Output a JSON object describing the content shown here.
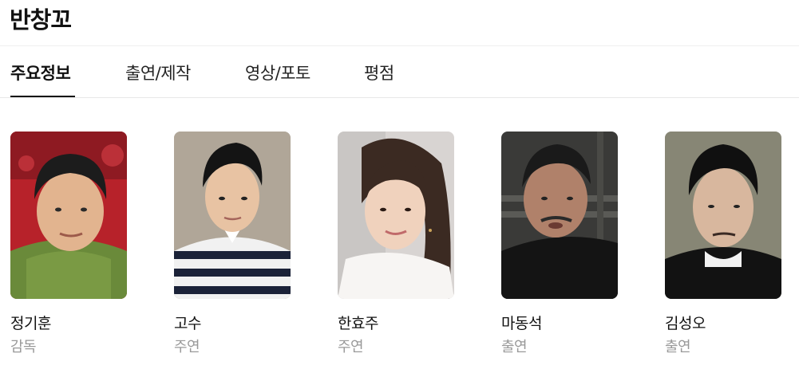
{
  "page": {
    "title": "반창꼬"
  },
  "tabs": [
    {
      "label": "주요정보",
      "active": true
    },
    {
      "label": "출연/제작",
      "active": false
    },
    {
      "label": "영상/포토",
      "active": false
    },
    {
      "label": "평점",
      "active": false
    }
  ],
  "cast": [
    {
      "name": "정기훈",
      "role": "감독",
      "photo_icon": "person-photo-director"
    },
    {
      "name": "고수",
      "role": "주연",
      "photo_icon": "person-photo-lead"
    },
    {
      "name": "한효주",
      "role": "주연",
      "photo_icon": "person-photo-lead"
    },
    {
      "name": "마동석",
      "role": "출연",
      "photo_icon": "person-photo-supporting"
    },
    {
      "name": "김성오",
      "role": "출연",
      "photo_icon": "person-photo-supporting"
    }
  ],
  "colors": {
    "text_primary": "#111111",
    "text_secondary": "#999999",
    "divider": "#e8e8e8"
  }
}
